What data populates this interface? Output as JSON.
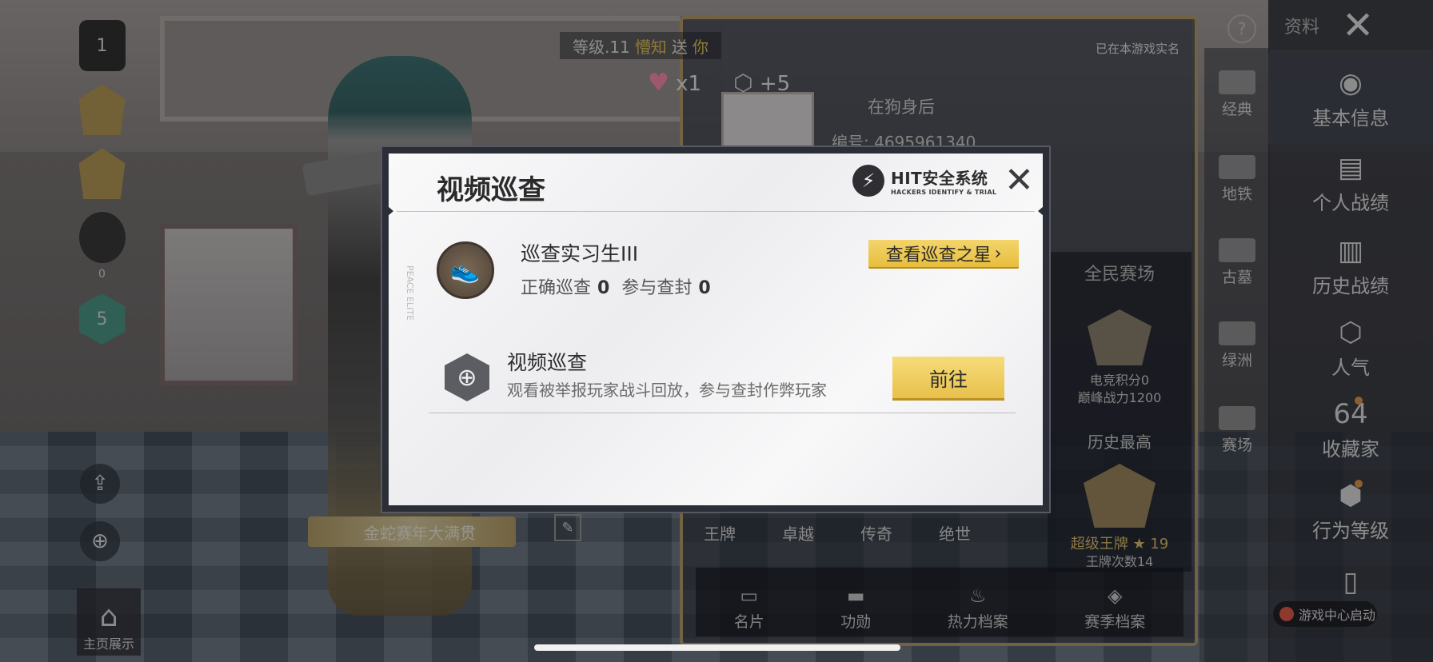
{
  "background": {
    "level_label": "等级.11",
    "gift_from": "懵知",
    "gift_verb": "送",
    "gift_to": "你",
    "heart_count": "x1",
    "ring_count": "+5",
    "profile_name": "在狗身后",
    "profile_id": "编号: 4695961340",
    "realname_notice": "已在本游戏实名",
    "stat_panel": {
      "title": "全民赛场",
      "score_line": "电竞积分0",
      "power_line": "巅峰战力1200",
      "history_title": "历史最高",
      "best_rank": "超级王牌 ★ 19",
      "ace_count": "王牌次数14"
    },
    "ranks": [
      "王牌",
      "卓越",
      "传奇",
      "绝世"
    ],
    "bottom_tabs": [
      "名片",
      "功勋",
      "热力档案",
      "赛季档案"
    ],
    "left_column": {
      "badge_1": "1",
      "badge_zero": "0",
      "badge_five": "5"
    },
    "event_banner": "金蛇赛年大满贯",
    "home_show": "主页展示",
    "middle_sidebar": [
      "经典",
      "地铁",
      "古墓",
      "绿洲",
      "赛场"
    ],
    "right_sidebar": {
      "header": "资料",
      "items": [
        "基本信息",
        "个人战绩",
        "历史战绩",
        "人气",
        "收藏家",
        "行为等级"
      ],
      "collector_badge": "64",
      "game_center": "游戏中心启动"
    }
  },
  "modal": {
    "title": "视频巡查",
    "logo_main": "HIT安全系统",
    "logo_sub": "HACKERS IDENTIFY & TRIAL",
    "rank": {
      "name": "巡查实习生III",
      "correct_label": "正确巡查",
      "correct_value": "0",
      "ban_label": "参与查封",
      "ban_value": "0"
    },
    "star_button": "查看巡查之星",
    "task": {
      "title": "视频巡查",
      "desc": "观看被举报玩家战斗回放，参与查封作弊玩家",
      "button": "前往"
    },
    "side_tag": "PEACE ELITE"
  },
  "icons": {
    "close": "✕",
    "chevron": "›",
    "bolt": "⚡",
    "target": "⊕"
  }
}
